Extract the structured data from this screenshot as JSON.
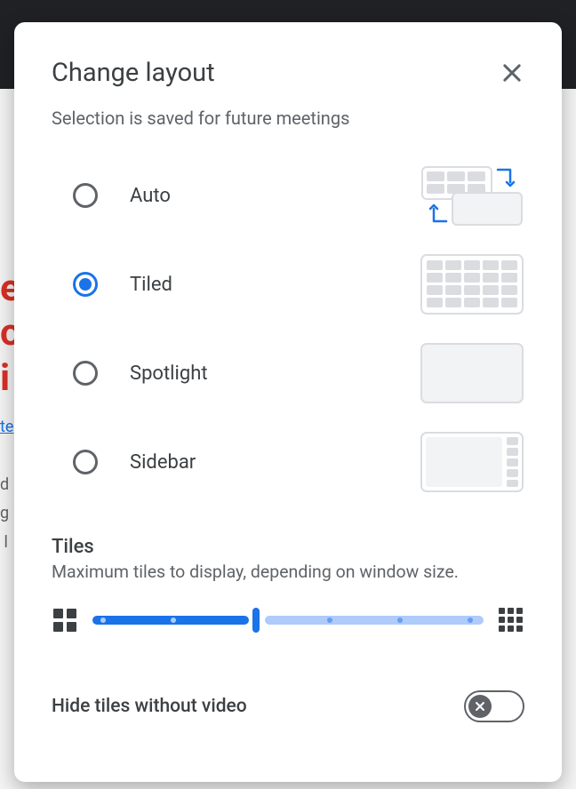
{
  "dialog": {
    "title": "Change layout",
    "subtitle": "Selection is saved for future meetings"
  },
  "options": [
    {
      "label": "Auto",
      "selected": false
    },
    {
      "label": "Tiled",
      "selected": true
    },
    {
      "label": "Spotlight",
      "selected": false
    },
    {
      "label": "Sidebar",
      "selected": false
    }
  ],
  "tiles": {
    "title": "Tiles",
    "subtitle": "Maximum tiles to display, depending on window size."
  },
  "toggle": {
    "label": "Hide tiles without video",
    "on": false
  },
  "colors": {
    "accent": "#1a73e8",
    "accent_light": "#aecbfa",
    "text": "#3c4043",
    "text_muted": "#5f6368",
    "border": "#dadce0"
  }
}
